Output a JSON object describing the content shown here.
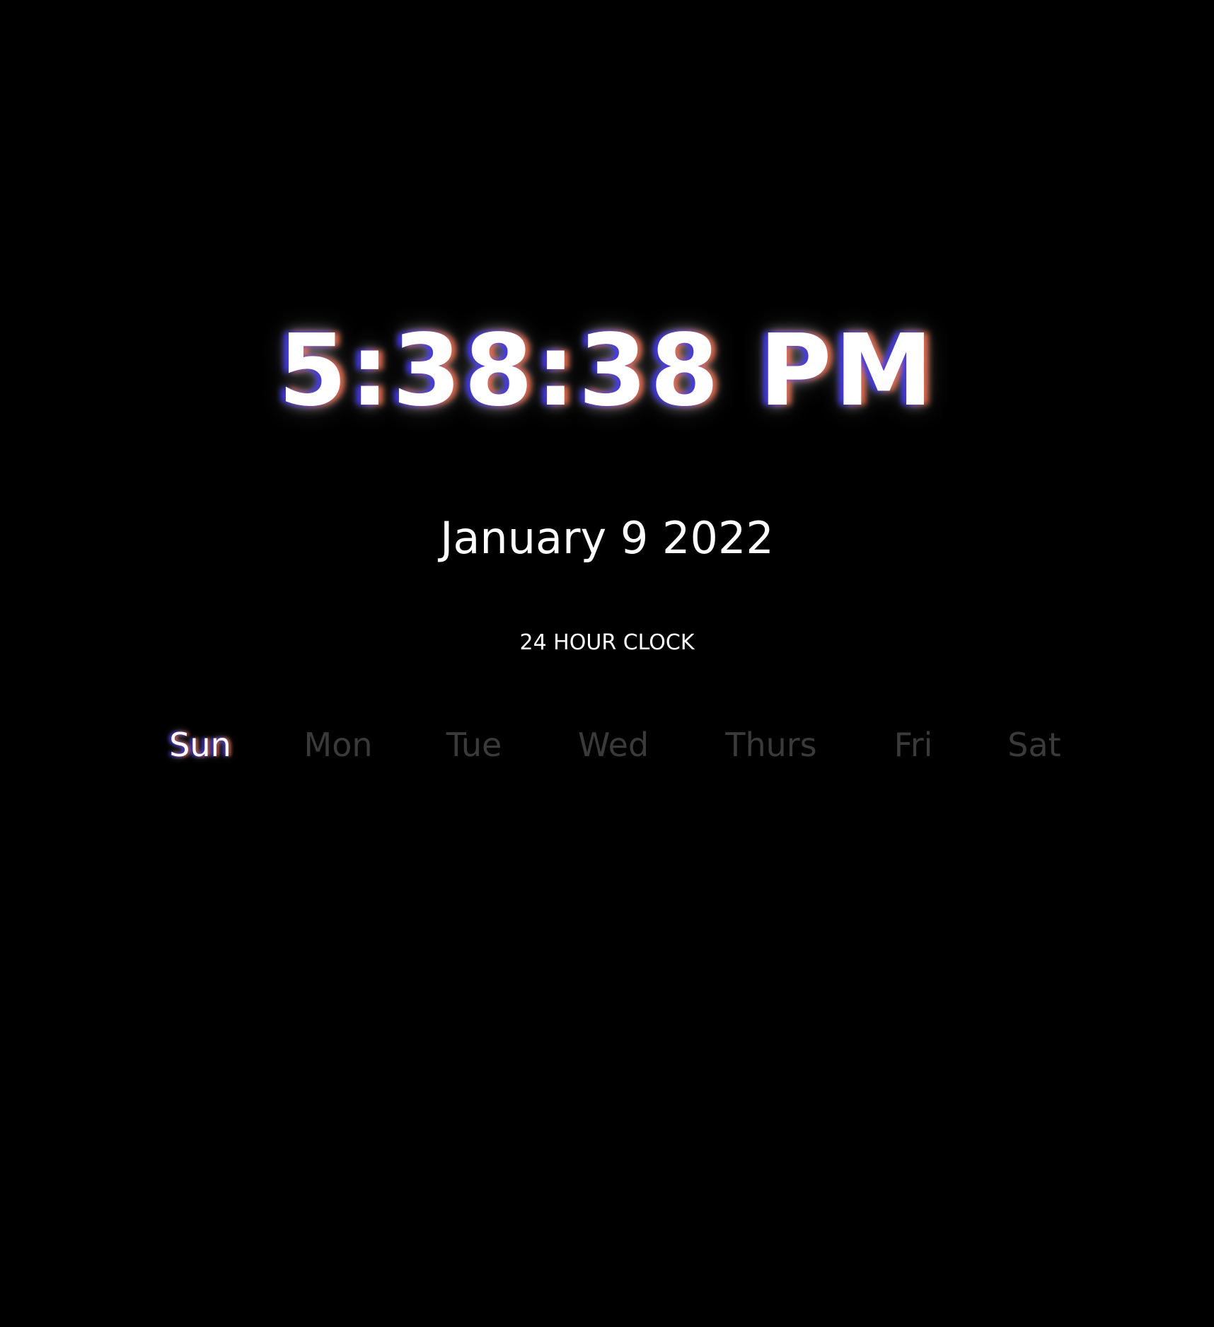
{
  "clock": {
    "time": "5:38:38 PM",
    "date": "January 9 2022",
    "toggle_label": "24 HOUR CLOCK"
  },
  "weekdays": {
    "active": "Sun",
    "items": [
      {
        "label": "Sun"
      },
      {
        "label": "Mon"
      },
      {
        "label": "Tue"
      },
      {
        "label": "Wed"
      },
      {
        "label": "Thurs"
      },
      {
        "label": "Fri"
      },
      {
        "label": "Sat"
      }
    ]
  },
  "colors": {
    "background": "#000000",
    "text": "#ffffff",
    "inactive_day": "#3a3a3a",
    "glow_left": "#3c32ff",
    "glow_right": "#ff6e46"
  }
}
